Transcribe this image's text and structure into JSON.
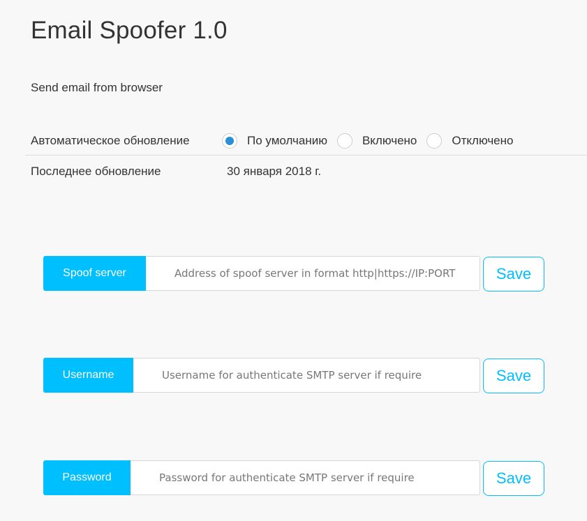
{
  "header": {
    "title": "Email Spoofer 1.0",
    "subtitle": "Send email from browser"
  },
  "auto_update": {
    "label": "Автоматическое обновление",
    "options": [
      {
        "label": "По умолчанию",
        "checked": true
      },
      {
        "label": "Включено",
        "checked": false
      },
      {
        "label": "Отключено",
        "checked": false
      }
    ]
  },
  "last_update": {
    "label": "Последнее обновление",
    "value": "30 января 2018 г."
  },
  "fields": {
    "spoof_server": {
      "label": "Spoof server",
      "value": "",
      "placeholder": "Address of spoof server in format http|https://IP:PORT",
      "save_label": "Save"
    },
    "username": {
      "label": "Username",
      "value": "",
      "placeholder": "Username for authenticate SMTP server if require",
      "save_label": "Save"
    },
    "password": {
      "label": "Password",
      "value": "",
      "placeholder": "Password for authenticate SMTP server if require",
      "save_label": "Save"
    }
  },
  "colors": {
    "accent": "#00bfff",
    "radio_checked": "#2b8fd6",
    "background": "#f8f8f8"
  }
}
